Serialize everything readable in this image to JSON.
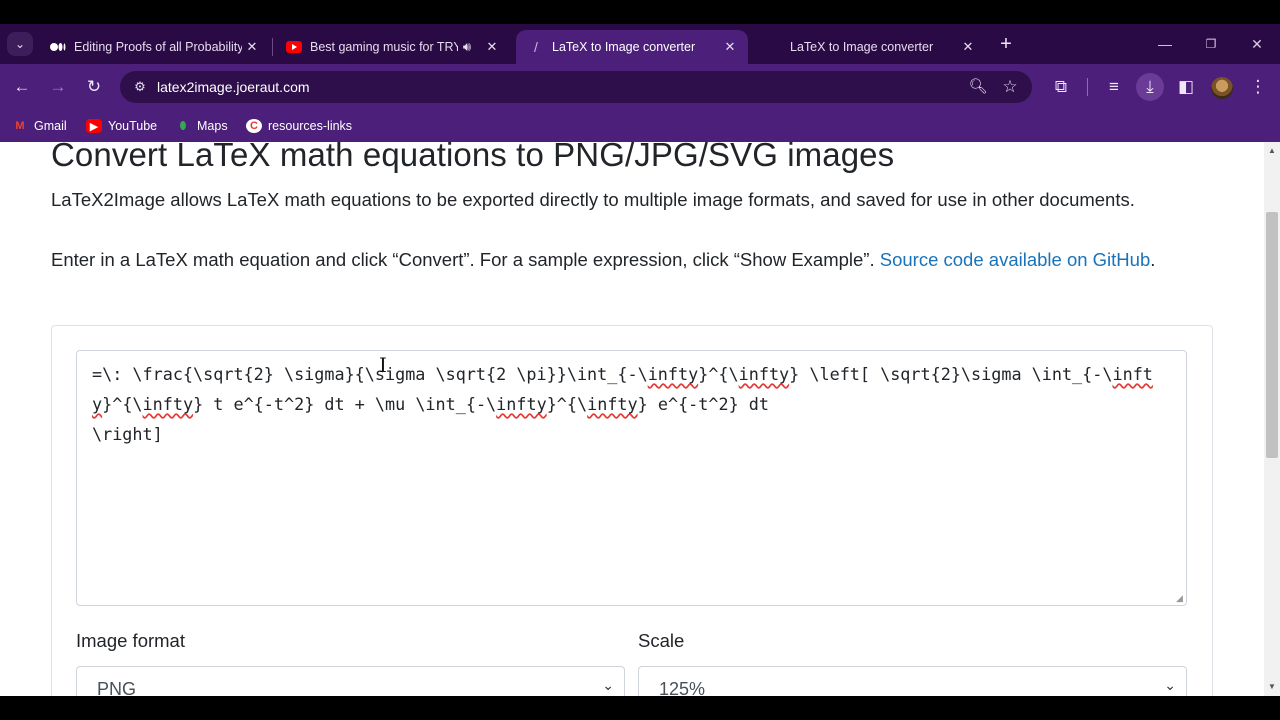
{
  "tabs": [
    {
      "title": "Editing Proofs of all Probability",
      "favicon": "medium-icon",
      "active": false,
      "audio": false
    },
    {
      "title": "Best gaming music for TRY",
      "favicon": "youtube-icon",
      "active": false,
      "audio": true
    },
    {
      "title": "LaTeX to Image converter",
      "favicon": "slash-icon",
      "active": true,
      "audio": false
    },
    {
      "title": "LaTeX to Image converter",
      "favicon": "none",
      "active": false,
      "audio": false
    }
  ],
  "window_controls": {
    "minimize": "—",
    "restore": "❐",
    "close": "✕"
  },
  "toolbar": {
    "url": "latex2image.joeraut.com"
  },
  "bookmarks": [
    {
      "label": "Gmail",
      "icon": "gmail-icon"
    },
    {
      "label": "YouTube",
      "icon": "youtube-icon"
    },
    {
      "label": "Maps",
      "icon": "maps-icon"
    },
    {
      "label": "resources-links",
      "icon": "resources-icon"
    }
  ],
  "page": {
    "heading": "Convert LaTeX math equations to PNG/JPG/SVG images",
    "intro": "LaTeX2Image allows LaTeX math equations to be exported directly to multiple image formats, and saved for use in other documents.",
    "instructions": "Enter in a LaTeX math equation and click “Convert”. For a sample expression, click “Show Example”. ",
    "source_link": "Source code available on GitHub",
    "source_link_suffix": ".",
    "latex": {
      "seg1": "=\\: \\frac{\\sqrt{2} \\sigma}{\\sigma \\sqrt{2 \\pi}}\\int_{-\\",
      "w1": "infty",
      "seg2": "}^{\\",
      "w2": "infty",
      "seg3": "} \\left[ \\sqrt{2}\\sigma \\int_{-\\",
      "w3": "infty",
      "seg4": "}^{\\",
      "w4": "infty",
      "seg5": "} t e^{-t^2} dt + \\mu \\int_{-\\",
      "w5": "infty",
      "seg6": "}^{\\",
      "w6": "infty",
      "seg7": "} e^{-t^2} dt\n\\right]"
    },
    "image_format_label": "Image format",
    "image_format_value": "PNG",
    "scale_label": "Scale",
    "scale_value": "125%"
  },
  "colors": {
    "tabstrip": "#2a0a44",
    "toolbar": "#4b1f7a",
    "link": "#1a73b8"
  }
}
